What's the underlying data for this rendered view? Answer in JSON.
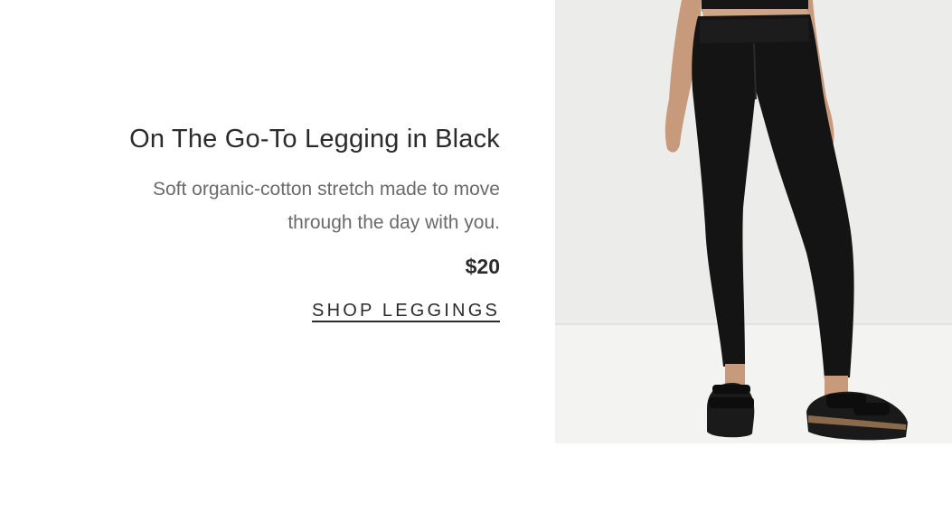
{
  "product": {
    "title": "On The Go-To Legging in Black",
    "description_line1": "Soft organic-cotton stretch made to move",
    "description_line2": "through the day with you.",
    "price": "$20",
    "cta_label": "SHOP LEGGINGS"
  },
  "image": {
    "subject": "model wearing black leggings and black sandals",
    "icon": "product-photo"
  },
  "colors": {
    "title": "#2b2b2b",
    "description": "#6a6a6a",
    "background": "#ffffff",
    "photo_wall": "#ececea",
    "photo_floor": "#f3f3f1",
    "garment": "#141414"
  }
}
